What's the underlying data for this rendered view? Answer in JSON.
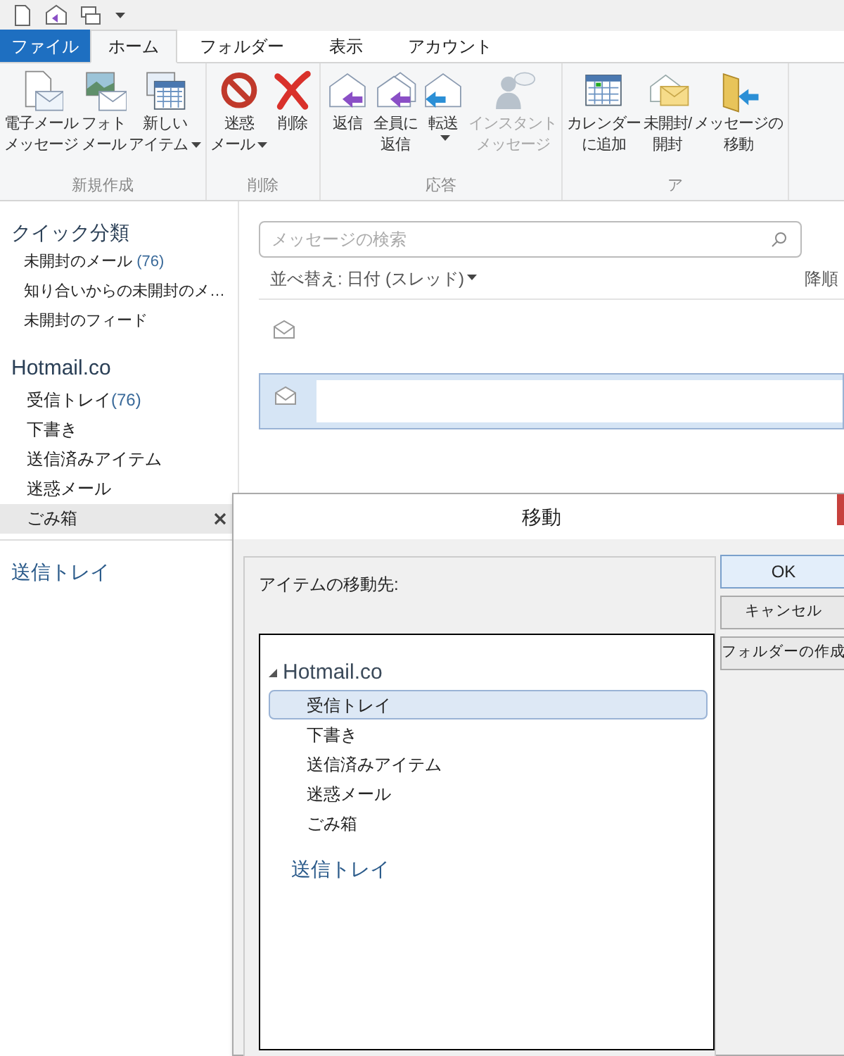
{
  "ribbon_tabs": [
    {
      "label": "ファイル",
      "kind": "file",
      "selected": false
    },
    {
      "label": "ホーム",
      "kind": "tab",
      "selected": true
    },
    {
      "label": "フォルダー",
      "kind": "tab",
      "selected": false
    },
    {
      "label": "表示",
      "kind": "tab",
      "selected": false
    },
    {
      "label": "アカウント",
      "kind": "tab",
      "selected": false
    }
  ],
  "ribbon_groups": [
    {
      "label": "新規作成",
      "buttons": [
        {
          "lines": [
            "電子メール",
            "メッセージ"
          ],
          "dropdown": false,
          "disabled": false
        },
        {
          "lines": [
            "フォト",
            "メール"
          ],
          "dropdown": false,
          "disabled": false
        },
        {
          "lines": [
            "新しい",
            "アイテム"
          ],
          "dropdown": true,
          "disabled": false
        }
      ]
    },
    {
      "label": "削除",
      "buttons": [
        {
          "lines": [
            "迷惑",
            "メール"
          ],
          "dropdown": true,
          "disabled": false
        },
        {
          "lines": [
            "削除"
          ],
          "dropdown": false,
          "disabled": false
        }
      ]
    },
    {
      "label": "応答",
      "buttons": [
        {
          "lines": [
            "返信"
          ],
          "dropdown": false,
          "disabled": false
        },
        {
          "lines": [
            "全員に",
            "返信"
          ],
          "dropdown": false,
          "disabled": false
        },
        {
          "lines": [
            "転送"
          ],
          "dropdown": true,
          "disabled": false
        },
        {
          "lines": [
            "インスタント",
            "メッセージ"
          ],
          "dropdown": false,
          "disabled": true
        }
      ]
    },
    {
      "label": "ア",
      "buttons": [
        {
          "lines": [
            "カレンダー",
            "に追加"
          ],
          "dropdown": false,
          "disabled": false
        },
        {
          "lines": [
            "未開封/",
            "開封"
          ],
          "dropdown": false,
          "disabled": false
        },
        {
          "lines": [
            "メッセージの",
            "移動"
          ],
          "dropdown": false,
          "disabled": false
        }
      ]
    }
  ],
  "sidebar": {
    "quick_heading": "クイック分類",
    "quick_items": [
      {
        "label": "未開封のメール",
        "count": "(76)"
      },
      {
        "label": "知り合いからの未開封のメ…"
      },
      {
        "label": "未開封のフィード"
      }
    ],
    "account": "Hotmail.co",
    "folders": [
      {
        "label": "受信トレイ",
        "count": "(76)",
        "selected": false
      },
      {
        "label": "下書き",
        "selected": false
      },
      {
        "label": "送信済みアイテム",
        "selected": false
      },
      {
        "label": "迷惑メール",
        "selected": false
      },
      {
        "label": "ごみ箱",
        "selected": true
      }
    ],
    "outbox": "送信トレイ"
  },
  "message_list": {
    "search": {
      "placeholder": "メッセージの検索"
    },
    "sort": "並べ替え: 日付 (スレッド)",
    "order": "降順",
    "rows": [
      {
        "selected": false
      },
      {
        "selected": true
      }
    ]
  },
  "dialog": {
    "title": "移動",
    "prompt": "アイテムの移動先:",
    "tree": {
      "label": "Hotmail.co",
      "expanded": true,
      "children": [
        {
          "label": "受信トレイ",
          "selected": true
        },
        {
          "label": "下書き",
          "selected": false
        },
        {
          "label": "送信済みアイテム",
          "selected": false
        },
        {
          "label": "迷惑メール",
          "selected": false
        },
        {
          "label": "ごみ箱",
          "selected": false
        }
      ]
    },
    "tree_outbox": "送信トレイ",
    "buttons": [
      {
        "label": "OK",
        "default": true
      },
      {
        "label": "キャンセル",
        "default": false
      },
      {
        "label": "フォルダーの作成",
        "default": false
      }
    ]
  }
}
